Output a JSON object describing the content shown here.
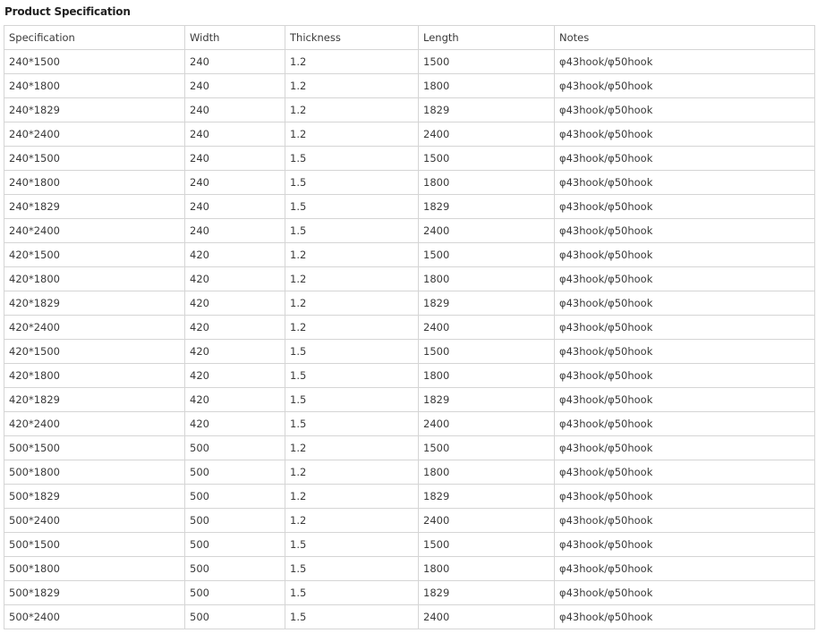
{
  "page_title": "Product Specification",
  "table": {
    "headers": [
      "Specification",
      "Width",
      "Thickness",
      "Length",
      "Notes"
    ],
    "rows": [
      [
        "240*1500",
        "240",
        "1.2",
        "1500",
        "φ43hook/φ50hook"
      ],
      [
        "240*1800",
        "240",
        "1.2",
        "1800",
        "φ43hook/φ50hook"
      ],
      [
        "240*1829",
        "240",
        "1.2",
        "1829",
        "φ43hook/φ50hook"
      ],
      [
        "240*2400",
        "240",
        "1.2",
        "2400",
        "φ43hook/φ50hook"
      ],
      [
        "240*1500",
        "240",
        "1.5",
        "1500",
        "φ43hook/φ50hook"
      ],
      [
        "240*1800",
        "240",
        "1.5",
        "1800",
        "φ43hook/φ50hook"
      ],
      [
        "240*1829",
        "240",
        "1.5",
        "1829",
        "φ43hook/φ50hook"
      ],
      [
        "240*2400",
        "240",
        "1.5",
        "2400",
        "φ43hook/φ50hook"
      ],
      [
        "420*1500",
        "420",
        "1.2",
        "1500",
        "φ43hook/φ50hook"
      ],
      [
        "420*1800",
        "420",
        "1.2",
        "1800",
        "φ43hook/φ50hook"
      ],
      [
        "420*1829",
        "420",
        "1.2",
        "1829",
        "φ43hook/φ50hook"
      ],
      [
        "420*2400",
        "420",
        "1.2",
        "2400",
        "φ43hook/φ50hook"
      ],
      [
        "420*1500",
        "420",
        "1.5",
        "1500",
        "φ43hook/φ50hook"
      ],
      [
        "420*1800",
        "420",
        "1.5",
        "1800",
        "φ43hook/φ50hook"
      ],
      [
        "420*1829",
        "420",
        "1.5",
        "1829",
        "φ43hook/φ50hook"
      ],
      [
        "420*2400",
        "420",
        "1.5",
        "2400",
        "φ43hook/φ50hook"
      ],
      [
        "500*1500",
        "500",
        "1.2",
        "1500",
        "φ43hook/φ50hook"
      ],
      [
        "500*1800",
        "500",
        "1.2",
        "1800",
        "φ43hook/φ50hook"
      ],
      [
        "500*1829",
        "500",
        "1.2",
        "1829",
        "φ43hook/φ50hook"
      ],
      [
        "500*2400",
        "500",
        "1.2",
        "2400",
        "φ43hook/φ50hook"
      ],
      [
        "500*1500",
        "500",
        "1.5",
        "1500",
        "φ43hook/φ50hook"
      ],
      [
        "500*1800",
        "500",
        "1.5",
        "1800",
        "φ43hook/φ50hook"
      ],
      [
        "500*1829",
        "500",
        "1.5",
        "1829",
        "φ43hook/φ50hook"
      ],
      [
        "500*2400",
        "500",
        "1.5",
        "2400",
        "φ43hook/φ50hook"
      ]
    ]
  },
  "colors": {
    "border": "#d5d5d5",
    "text": "#3a3a3a",
    "title": "#222222"
  }
}
